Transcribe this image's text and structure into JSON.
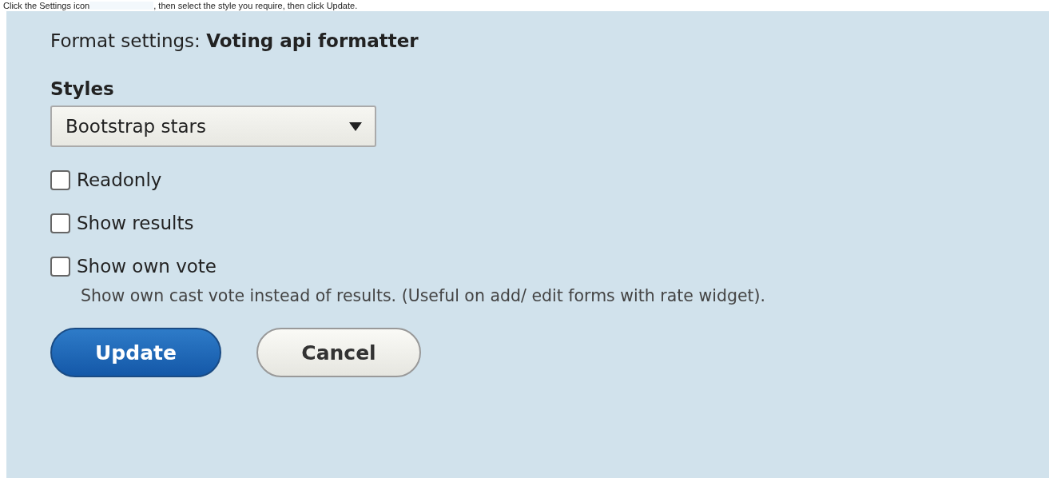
{
  "instruction": {
    "before": "Click the Settings icon",
    "after": ", then select the style you require, then click Update."
  },
  "panel": {
    "title_prefix": "Format settings:",
    "title_name": "Voting api formatter",
    "styles_label": "Styles",
    "styles_value": "Bootstrap stars",
    "options": [
      {
        "label": "Readonly",
        "checked": false
      },
      {
        "label": "Show results",
        "checked": false
      },
      {
        "label": "Show own vote",
        "checked": false,
        "description": "Show own cast vote instead of results. (Useful on add/ edit forms with rate widget)."
      }
    ],
    "buttons": [
      {
        "label": "Update",
        "kind": "primary"
      },
      {
        "label": "Cancel",
        "kind": "secondary"
      }
    ]
  }
}
